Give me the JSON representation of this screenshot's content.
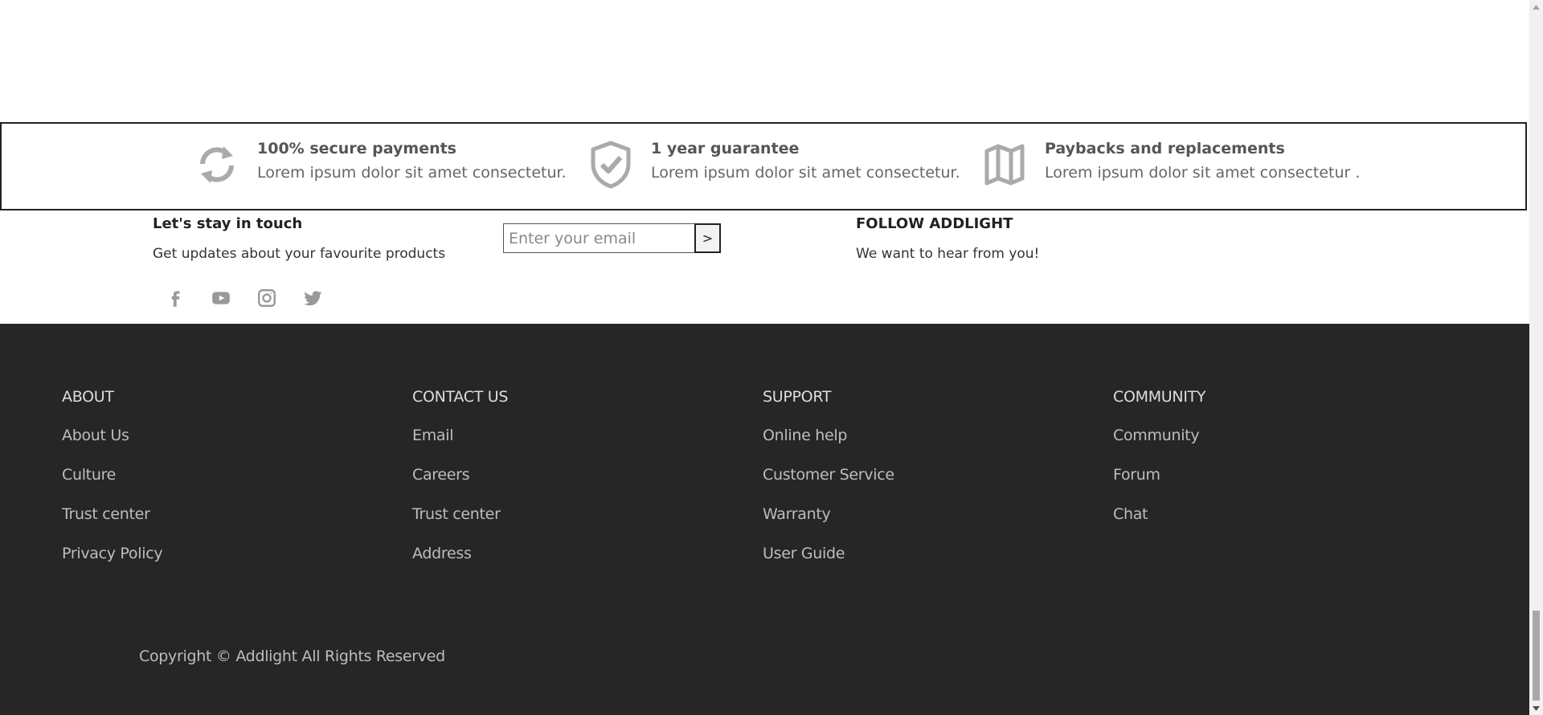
{
  "features": [
    {
      "icon": "refresh-icon",
      "title": "100% secure payments",
      "desc": "Lorem ipsum dolor sit amet consectetur."
    },
    {
      "icon": "shield-check-icon",
      "title": "1 year guarantee",
      "desc": "Lorem ipsum dolor sit amet consectetur."
    },
    {
      "icon": "map-icon",
      "title": "Paybacks and replacements",
      "desc": "Lorem ipsum dolor sit amet consectetur ."
    }
  ],
  "newsletter": {
    "title": "Let's stay in touch",
    "subtitle": "Get updates about your favourite products",
    "email_placeholder": "Enter your email",
    "submit_label": ">"
  },
  "follow": {
    "title": "FOLLOW ADDLIGHT",
    "subtitle": "We want to hear from you!"
  },
  "social": [
    "facebook-icon",
    "youtube-icon",
    "instagram-icon",
    "twitter-icon"
  ],
  "footer": {
    "columns": [
      {
        "title": "ABOUT",
        "links": [
          "About Us",
          "Culture",
          "Trust center",
          "Privacy Policy"
        ]
      },
      {
        "title": "CONTACT US",
        "links": [
          "Email",
          "Careers",
          "Trust center",
          "Address"
        ]
      },
      {
        "title": "SUPPORT",
        "links": [
          "Online help",
          "Customer Service",
          "Warranty",
          "User Guide"
        ]
      },
      {
        "title": "COMMUNITY",
        "links": [
          "Community",
          "Forum",
          "Chat"
        ]
      }
    ],
    "copyright": "Copyright © Addlight All Rights Reserved"
  },
  "colors": {
    "footer_bg": "#262626",
    "icon_gray": "#aaaaaa",
    "feature_text": "#555555"
  }
}
